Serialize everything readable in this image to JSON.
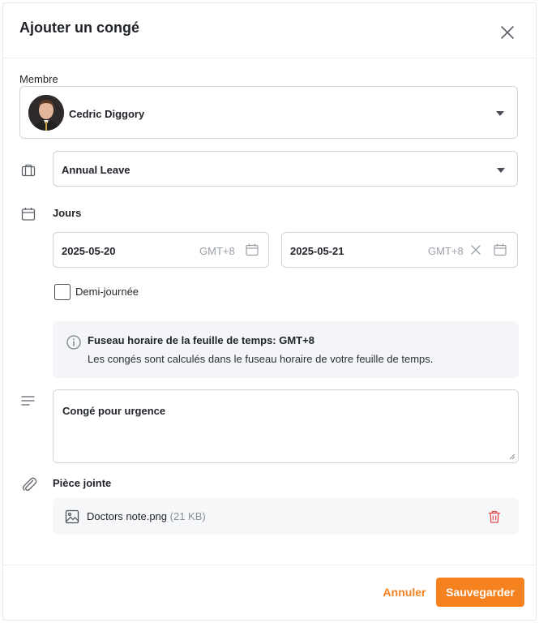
{
  "header": {
    "title": "Ajouter un congé"
  },
  "member": {
    "label": "Membre",
    "name": "Cedric Diggory"
  },
  "leave_type": {
    "value": "Annual Leave"
  },
  "days": {
    "label": "Jours",
    "start_date": "2025-05-20",
    "start_tz": "GMT+8",
    "end_date": "2025-05-21",
    "end_tz": "GMT+8"
  },
  "half_day": {
    "label": "Demi-journée",
    "checked": false
  },
  "info": {
    "title": "Fuseau horaire de la feuille de temps: GMT+8",
    "body": "Les congés sont calculés dans le fuseau horaire de votre feuille de temps."
  },
  "note": {
    "value": "Congé pour urgence"
  },
  "attachment": {
    "label": "Pièce jointe",
    "file_name": "Doctors note.png",
    "file_size": "(21 KB)"
  },
  "footer": {
    "cancel_label": "Annuler",
    "save_label": "Sauvegarder"
  },
  "colors": {
    "accent": "#f5821f",
    "delete": "#e5484d",
    "border": "#d0d3d8"
  }
}
